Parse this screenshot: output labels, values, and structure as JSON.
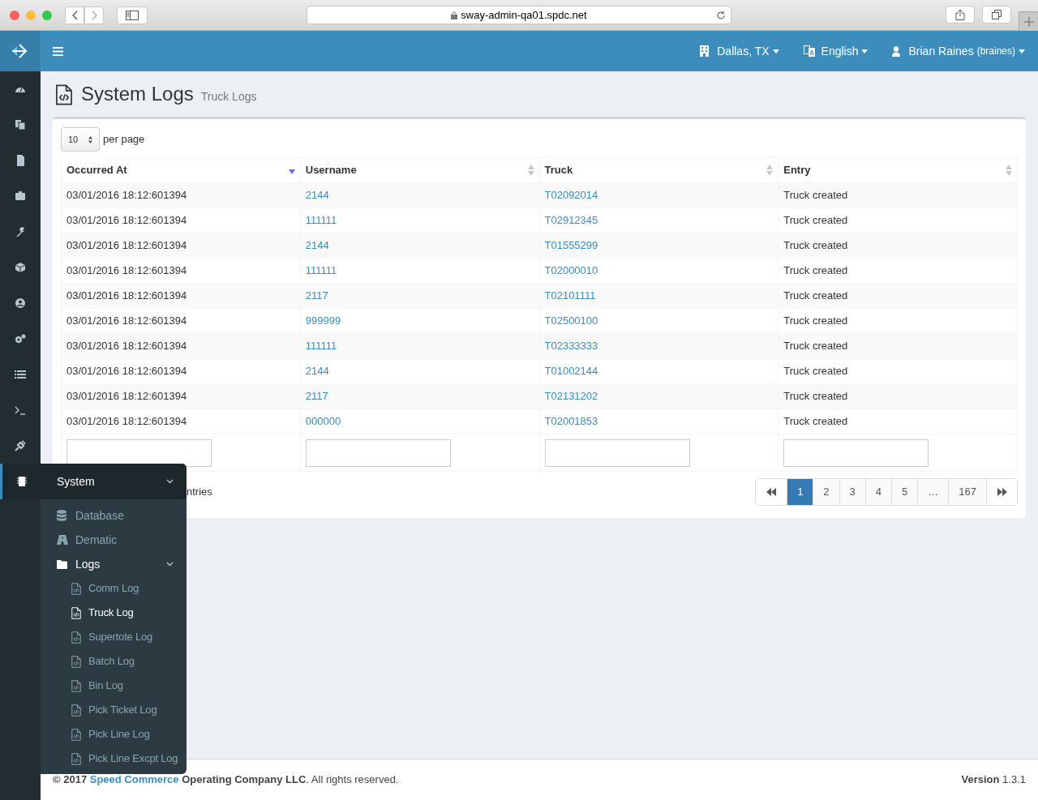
{
  "browser": {
    "url": "sway-admin-qa01.spdc.net"
  },
  "topbar": {
    "location": "Dallas, TX",
    "language": "English",
    "user_name": "Brian Raines",
    "user_login": "(braines)"
  },
  "sidebar": {
    "items": [
      {
        "selected": false
      },
      {
        "selected": false
      },
      {
        "selected": false
      },
      {
        "selected": false
      },
      {
        "selected": false
      },
      {
        "selected": false
      },
      {
        "selected": false
      },
      {
        "selected": false
      },
      {
        "selected": false
      },
      {
        "selected": false
      },
      {
        "selected": false
      },
      {
        "selected": true
      }
    ]
  },
  "page": {
    "title": "System Logs",
    "subtitle": "Truck Logs"
  },
  "per_page": {
    "value": "10",
    "label": "per page"
  },
  "table": {
    "columns": [
      {
        "label": "Occurred At",
        "sorted": true
      },
      {
        "label": "Username",
        "sorted": false
      },
      {
        "label": "Truck",
        "sorted": false
      },
      {
        "label": "Entry",
        "sorted": false
      }
    ],
    "rows": [
      [
        "03/01/2016 18:12:601394",
        "2144",
        "T02092014",
        "Truck created"
      ],
      [
        "03/01/2016 18:12:601394",
        "111111",
        "T02912345",
        "Truck created"
      ],
      [
        "03/01/2016 18:12:601394",
        "2144",
        "T01555299",
        "Truck created"
      ],
      [
        "03/01/2016 18:12:601394",
        "111111",
        "T02000010",
        "Truck created"
      ],
      [
        "03/01/2016 18:12:601394",
        "2117",
        "T02101111",
        "Truck created"
      ],
      [
        "03/01/2016 18:12:601394",
        "999999",
        "T02500100",
        "Truck created"
      ],
      [
        "03/01/2016 18:12:601394",
        "111111",
        "T02333333",
        "Truck created"
      ],
      [
        "03/01/2016 18:12:601394",
        "2144",
        "T01002144",
        "Truck created"
      ],
      [
        "03/01/2016 18:12:601394",
        "2117",
        "T02131202",
        "Truck created"
      ],
      [
        "03/01/2016 18:12:601394",
        "000000",
        "T02001853",
        "Truck created"
      ]
    ]
  },
  "info_text": "ntries",
  "pagination": {
    "pages": [
      {
        "label": "1",
        "selected": true
      },
      {
        "label": "2",
        "selected": false
      },
      {
        "label": "3",
        "selected": false
      },
      {
        "label": "4",
        "selected": false
      },
      {
        "label": "5",
        "selected": false
      },
      {
        "label": "…",
        "selected": false
      },
      {
        "label": "167",
        "selected": false
      }
    ]
  },
  "flyout": {
    "title": "System",
    "items": [
      {
        "label": "Database",
        "kind": "item"
      },
      {
        "label": "Dematic",
        "kind": "item"
      },
      {
        "label": "Logs",
        "kind": "folder",
        "expanded": true,
        "children": [
          {
            "label": "Comm Log",
            "selected": false
          },
          {
            "label": "Truck Log",
            "selected": true
          },
          {
            "label": "Supertote Log",
            "selected": false
          },
          {
            "label": "Batch Log",
            "selected": false
          },
          {
            "label": "Bin Log",
            "selected": false
          },
          {
            "label": "Pick Ticket Log",
            "selected": false
          },
          {
            "label": "Pick Line Log",
            "selected": false
          },
          {
            "label": "Pick Line Excpt Log",
            "selected": false
          }
        ]
      }
    ]
  },
  "footer": {
    "prefix": "**© 2017**",
    "link": "Speed Commerce",
    "suffix": "**Operating Company LLC**. All rights reserved.",
    "version_label": "Version",
    "version": "1.3.1"
  }
}
